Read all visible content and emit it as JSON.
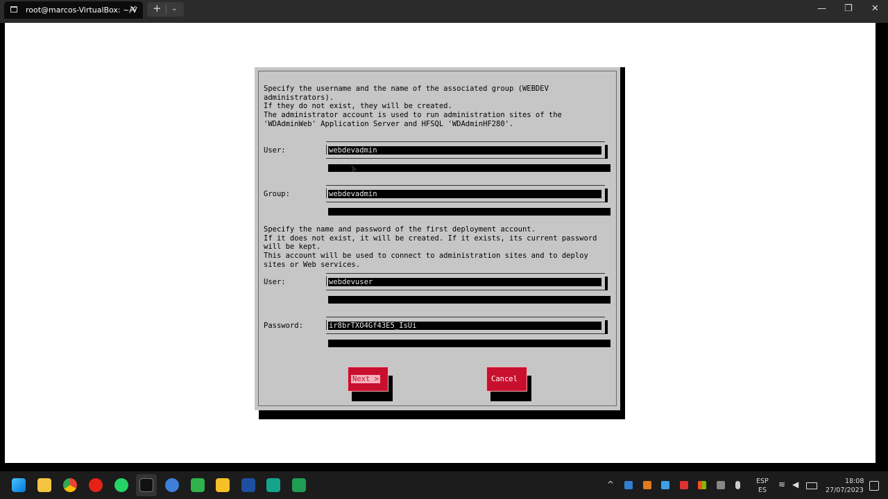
{
  "window": {
    "tab_title": "root@marcos-VirtualBox: ~/V",
    "icons": {
      "terminal": "terminal-icon",
      "close": "close-icon",
      "new_tab": "plus-icon",
      "dropdown": "chevron-down-icon"
    },
    "controls": {
      "minimize": "—",
      "maximize": "❐",
      "close": "✕"
    }
  },
  "dialog": {
    "intro": "Specify the username and the name of the associated group (WEBDEV\nadministrators).\nIf they do not exist, they will be created.\nThe administrator account is used to run administration sites of the\n'WDAdminWeb' Application Server and HFSQL 'WDAdminHF280'.",
    "admin_user": {
      "label": "User:",
      "value": "webdevadmin"
    },
    "admin_group": {
      "label": "Group:",
      "value": "webdevadmin"
    },
    "deploy_intro": "Specify the name and password of the first deployment account.\nIf it does not exist, it will be created. If it exists, its current password\nwill be kept.\nThis account will be used to connect to administration sites and to deploy\nsites or Web services.",
    "deploy_user": {
      "label": "User:",
      "value": "webdevuser"
    },
    "deploy_password": {
      "label": "Password:",
      "value": "ir8brTXO4Gf43E5_IsUi"
    },
    "buttons": {
      "next": "Next >",
      "cancel": "Cancel"
    }
  },
  "taskbar": {
    "apps": [
      "windows-start-icon",
      "file-explorer-icon",
      "chrome-icon",
      "youtube-music-icon",
      "whatsapp-icon",
      "terminal-icon",
      "browser-icon",
      "recycle-icon",
      "notes-icon",
      "vscode-icon",
      "app-installer-icon",
      "sheets-icon"
    ],
    "language": {
      "line1": "ESP",
      "line2": "ES"
    },
    "time": "18:08",
    "date": "27/07/2023"
  },
  "colors": {
    "accent_red": "#c8102e",
    "dialog_bg": "#c6c6c6"
  }
}
